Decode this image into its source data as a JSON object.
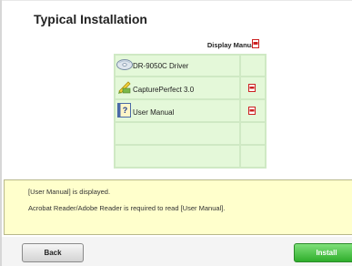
{
  "title": "Typical Installation",
  "display_manual_label": "Display Manual:",
  "items": [
    {
      "label": "DR-9050C Driver",
      "icon": "cd-icon",
      "has_pdf": false
    },
    {
      "label": "CapturePerfect 3.0",
      "icon": "scanner-app-icon",
      "has_pdf": true
    },
    {
      "label": "User Manual",
      "icon": "manual-help-icon",
      "has_pdf": true
    }
  ],
  "info": {
    "line1": "[User Manual] is displayed.",
    "line2": "Acrobat Reader/Adobe Reader is required to read [User Manual]."
  },
  "buttons": {
    "back": "Back",
    "install": "Install"
  },
  "colors": {
    "grid_border": "#cfe9c4",
    "grid_cell": "#e4f8d9",
    "info_bg": "#ffffcc",
    "install_green": "#3fbf3a",
    "pdf_red": "#cc2222"
  }
}
